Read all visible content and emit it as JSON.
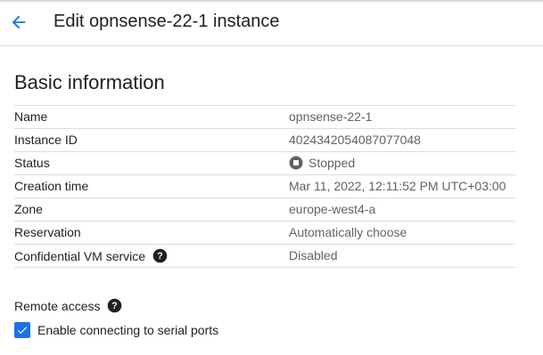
{
  "header": {
    "title": "Edit opnsense-22-1 instance",
    "back_icon": "arrow-back-icon"
  },
  "basic_info": {
    "title": "Basic information",
    "rows": [
      {
        "label": "Name",
        "value": "opnsense-22-1"
      },
      {
        "label": "Instance ID",
        "value": "4024342054087077048"
      },
      {
        "label": "Status",
        "value": "Stopped",
        "icon": "stopped-status-icon"
      },
      {
        "label": "Creation time",
        "value": "Mar 11, 2022, 12:11:52 PM UTC+03:00"
      },
      {
        "label": "Zone",
        "value": "europe-west4-a"
      },
      {
        "label": "Reservation",
        "value": "Automatically choose"
      },
      {
        "label": "Confidential VM service",
        "value": "Disabled",
        "help": true
      }
    ]
  },
  "remote_access": {
    "label": "Remote access",
    "checkbox_label": "Enable connecting to serial ports",
    "checked": true
  },
  "colors": {
    "accent": "#1a73e8",
    "text": "#202124",
    "secondary_text": "#5f6368",
    "divider": "#dadce0"
  }
}
